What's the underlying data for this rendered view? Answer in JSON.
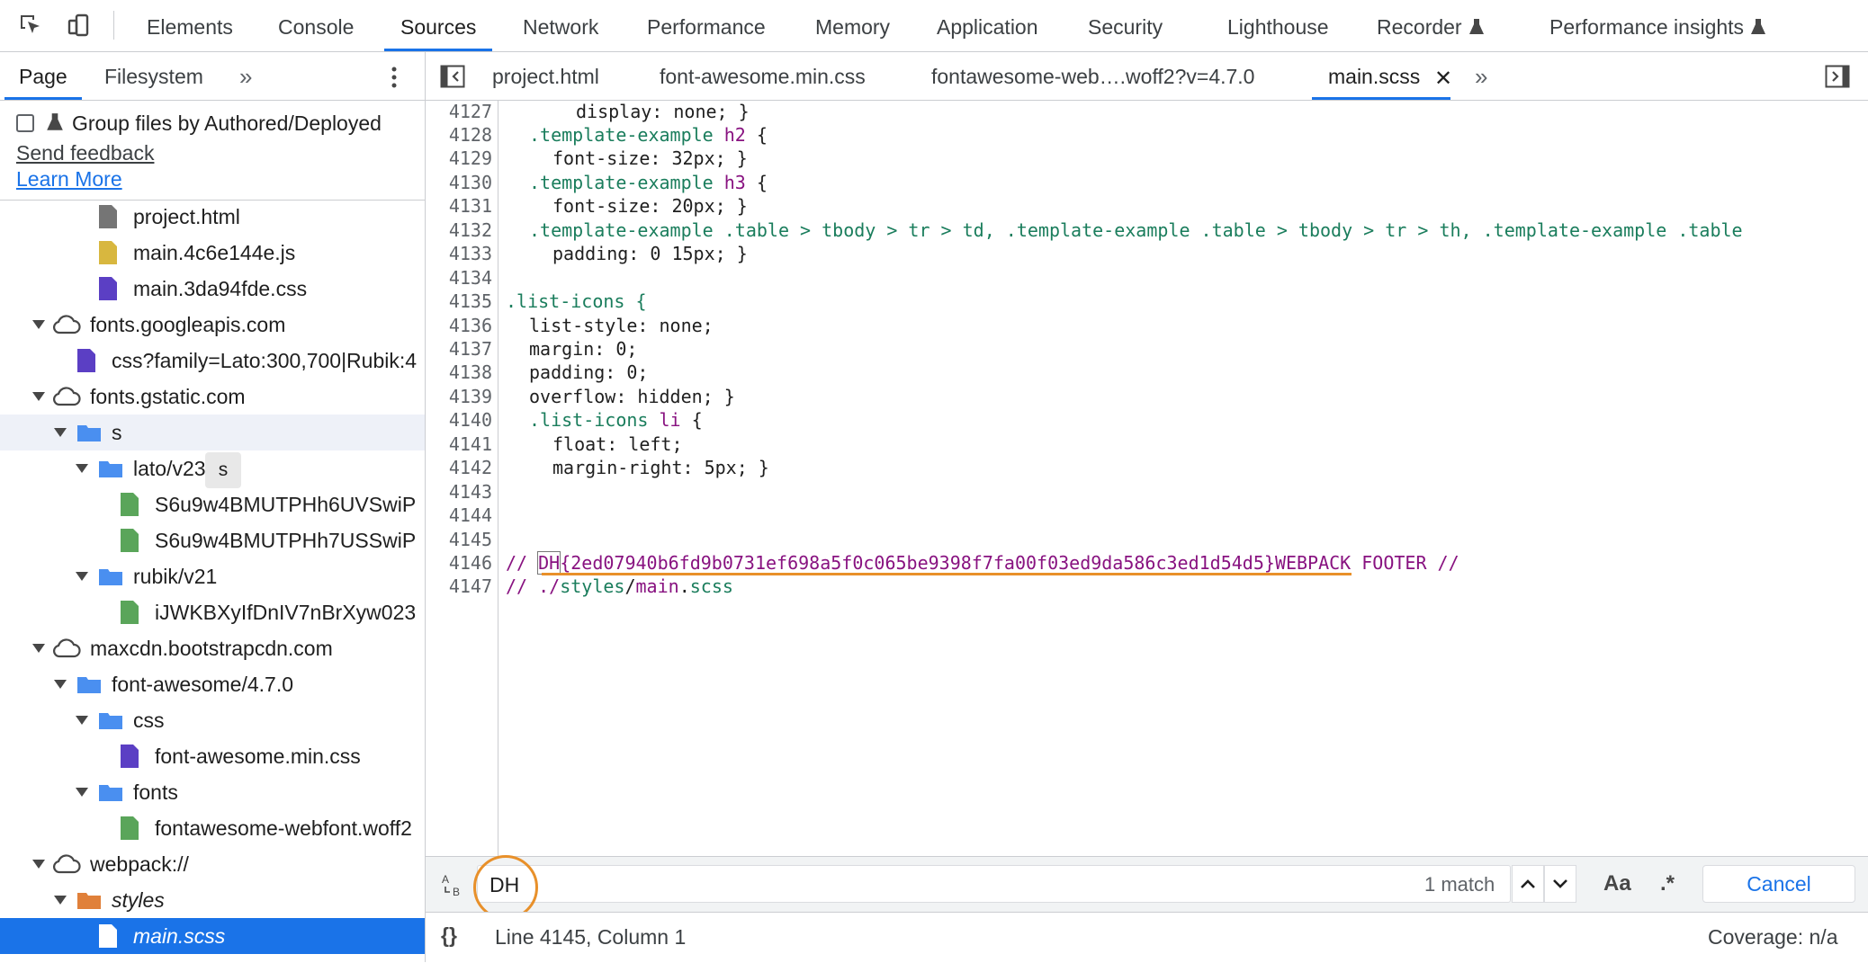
{
  "toolbar": {
    "tabs": [
      "Elements",
      "Console",
      "Sources",
      "Network",
      "Performance",
      "Memory",
      "Application",
      "Security",
      "Lighthouse",
      "Recorder",
      "Performance insights"
    ],
    "active_tab": "Sources"
  },
  "navigator": {
    "tabs": [
      "Page",
      "Filesystem"
    ],
    "more": "»",
    "group_label": "Group files by Authored/Deployed",
    "send_feedback": "Send feedback",
    "learn_more": "Learn More",
    "tooltip": "s",
    "tree": [
      {
        "label": "project.html",
        "type": "file-gray"
      },
      {
        "label": "main.4c6e144e.js",
        "type": "file-yellow"
      },
      {
        "label": "main.3da94fde.css",
        "type": "file-purple"
      },
      {
        "label": "fonts.googleapis.com",
        "type": "domain"
      },
      {
        "label": "css?family=Lato:300,700|Rubik:4",
        "type": "file-purple"
      },
      {
        "label": "fonts.gstatic.com",
        "type": "domain"
      },
      {
        "label": "s",
        "type": "folder"
      },
      {
        "label": "lato/v23",
        "type": "folder"
      },
      {
        "label": "S6u9w4BMUTPHh6UVSwiP",
        "type": "file-green"
      },
      {
        "label": "S6u9w4BMUTPHh7USSwiP",
        "type": "file-green"
      },
      {
        "label": "rubik/v21",
        "type": "folder"
      },
      {
        "label": "iJWKBXyIfDnIV7nBrXyw023",
        "type": "file-green"
      },
      {
        "label": "maxcdn.bootstrapcdn.com",
        "type": "domain"
      },
      {
        "label": "font-awesome/4.7.0",
        "type": "folder"
      },
      {
        "label": "css",
        "type": "folder"
      },
      {
        "label": "font-awesome.min.css",
        "type": "file-purple"
      },
      {
        "label": "fonts",
        "type": "folder"
      },
      {
        "label": "fontawesome-webfont.woff2",
        "type": "file-green"
      },
      {
        "label": "webpack://",
        "type": "domain"
      },
      {
        "label": "styles",
        "type": "folder-orange"
      },
      {
        "label": "main.scss",
        "type": "file-white"
      }
    ]
  },
  "editor": {
    "tabs": [
      "project.html",
      "font-awesome.min.css",
      "fontawesome-web….woff2?v=4.7.0",
      "main.scss"
    ],
    "active_tab": "main.scss",
    "line_numbers": [
      "4127",
      "4128",
      "4129",
      "4130",
      "4131",
      "4132",
      "4133",
      "4134",
      "4135",
      "4136",
      "4137",
      "4138",
      "4139",
      "4140",
      "4141",
      "4142",
      "4143",
      "4144",
      "4145",
      "4146",
      "4147"
    ],
    "code": {
      "l4127": "display: none; }",
      "l4128_sel": ".template-example",
      "l4128_tag": "h2",
      "l4129": "font-size: 32px; }",
      "l4130_sel": ".template-example",
      "l4130_tag": "h3",
      "l4131": "font-size: 20px; }",
      "l4132": ".template-example .table > tbody > tr > td, .template-example .table > tbody > tr > th, .template-example .table",
      "l4133": "padding: 0 15px; }",
      "l4135": ".list-icons {",
      "l4136": "list-style: none;",
      "l4137": "margin: 0;",
      "l4138": "padding: 0;",
      "l4139": "overflow: hidden; }",
      "l4140_sel": ".list-icons",
      "l4140_tag": "li",
      "l4141": "float: left;",
      "l4142": "margin-right: 5px; }",
      "l4146_prefix": "// ",
      "l4146_match": "DH",
      "l4146_hash": "{2ed07940b6fd9b0731ef698a5f0c065be9398f7fa00f03ed9da586c3ed1d54d5}",
      "l4146_suffix": "WEBPACK FOOTER //",
      "l4147_prefix": "// ./",
      "l4147_path1": "styles",
      "l4147_slash": "/",
      "l4147_path2": "main",
      "l4147_dot": ".",
      "l4147_path3": "scss"
    }
  },
  "search": {
    "query": "DH",
    "match_count": "1 match",
    "case_label": "Aa",
    "regex_label": ".*",
    "cancel": "Cancel"
  },
  "status": {
    "braces": "{}",
    "position": "Line 4145, Column 1",
    "coverage": "Coverage: n/a"
  },
  "colors": {
    "accent": "#1a73e8",
    "highlight_circle": "#e8902a"
  }
}
